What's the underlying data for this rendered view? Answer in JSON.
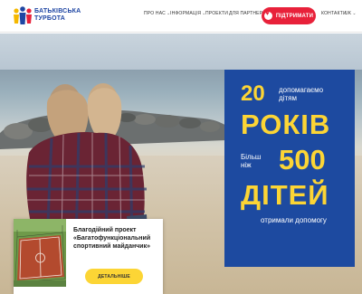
{
  "header": {
    "logo_line1": "Батьківська",
    "logo_line2": "турбота",
    "nav": [
      {
        "label": "ПРО НАС",
        "has_dropdown": true
      },
      {
        "label": "ІНФОРМАЦІЯ",
        "has_dropdown": true
      },
      {
        "label": "ПРОЕКТИ",
        "has_dropdown": false
      },
      {
        "label": "ДЛЯ ПАРТНЕРІВ",
        "has_dropdown": false
      }
    ],
    "support_label": "ПІДТРИМАТИ",
    "contacts_label": "КОНТАКТИ",
    "language": "UK"
  },
  "hero": {
    "stat_years_number": "20",
    "stat_years_text_line1": "допомагаємо",
    "stat_years_text_line2": "дітям",
    "stat_years_unit": "РОКІВ",
    "stat_children_prefix_line1": "Більш",
    "stat_children_prefix_line2": "ніж",
    "stat_children_number": "500",
    "stat_children_unit": "ДІТЕЙ",
    "stat_children_caption": "отримали допомогу"
  },
  "project_card": {
    "title_line1": "Благодійний проект",
    "title_line2": "«Багатофункціональний",
    "title_line3": "спортивний майданчик»",
    "button_label": "ДЕТАЛЬНІШЕ"
  },
  "colors": {
    "brand_blue": "#1d4aa0",
    "accent_yellow": "#fcd535",
    "support_red": "#e8213a"
  }
}
